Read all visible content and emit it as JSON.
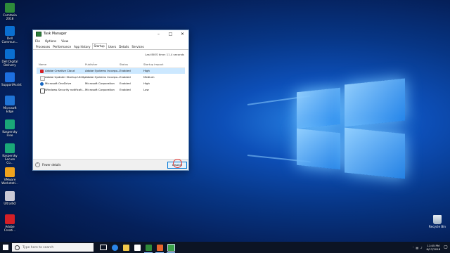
{
  "desktop_icons": [
    {
      "label": "Camtasia\n2018",
      "color": "#2e8b3a"
    },
    {
      "label": "Dell\nCommun...",
      "color": "#0a6fd1"
    },
    {
      "label": "Dell Digital\nDelivery",
      "color": "#0a6fd1"
    },
    {
      "label": "SupportAssist",
      "color": "#1d6fe0"
    },
    {
      "label": "Microsoft\nEdge",
      "color": "#1f74d6"
    },
    {
      "label": "Kaspersky\nFree",
      "color": "#1aa878"
    },
    {
      "label": "Kaspersky\nSecure Co...",
      "color": "#1aa878"
    },
    {
      "label": "VMware\nWorkstati...",
      "color": "#f0a31d"
    },
    {
      "label": "UltraISO",
      "color": "#c9c9d6"
    },
    {
      "label": "Adobe\nCreati...",
      "color": "#d41f26"
    }
  ],
  "task_manager": {
    "title": "Task Manager",
    "menu": [
      "File",
      "Options",
      "View"
    ],
    "tabs": [
      "Processes",
      "Performance",
      "App history",
      "Startup",
      "Users",
      "Details",
      "Services"
    ],
    "active_tab": "Startup",
    "bios_time": "Last BIOS time:  11.4 seconds",
    "columns": [
      "Name",
      "Publisher",
      "Status",
      "Startup impact"
    ],
    "rows": [
      {
        "name": "Adobe Creative Cloud",
        "publisher": "Adobe Systems Incorpo...",
        "status": "Enabled",
        "impact": "High",
        "selected": true,
        "icon_color": "#d41f26"
      },
      {
        "name": "Adobe Updater Startup Utility",
        "publisher": "Adobe Systems Incorpo...",
        "status": "Enabled",
        "impact": "Medium",
        "selected": false,
        "icon_color": "#d41f26"
      },
      {
        "name": "Microsoft OneDrive",
        "publisher": "Microsoft Corporation",
        "status": "Enabled",
        "impact": "High",
        "selected": false,
        "icon_color": "#1565c0"
      },
      {
        "name": "Windows Security notificati...",
        "publisher": "Microsoft Corporation",
        "status": "Enabled",
        "impact": "Low",
        "selected": false,
        "icon_color": "#555555"
      }
    ],
    "fewer_details": "Fewer details",
    "disable_button": "Disable"
  },
  "recycle_bin": {
    "label": "Recycle Bin"
  },
  "taskbar": {
    "search_placeholder": "Type here to search",
    "apps": [
      {
        "name": "task-view",
        "color": "#ffffff"
      },
      {
        "name": "edge",
        "color": "#2b86e8"
      },
      {
        "name": "file-explorer",
        "color": "#f2c94c"
      },
      {
        "name": "store",
        "color": "#ffffff"
      },
      {
        "name": "camtasia",
        "color": "#2e8b3a"
      },
      {
        "name": "camtasia-recorder",
        "color": "#e8662e"
      },
      {
        "name": "task-manager",
        "color": "#3aa14a"
      }
    ],
    "clock_time": "11:05 PM",
    "clock_date": "8/17/2018"
  }
}
